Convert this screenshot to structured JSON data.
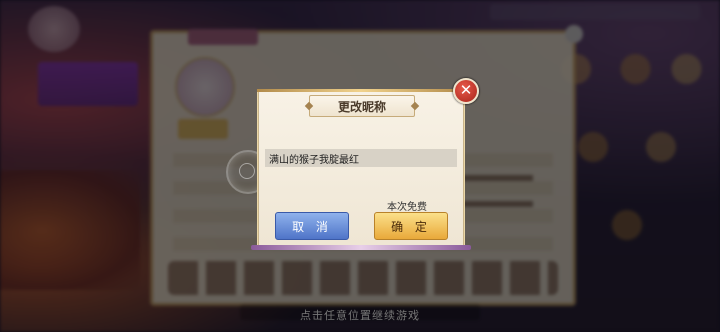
{
  "dialog": {
    "title": "更改昵称",
    "name_value": "满山的猴子我腚最红",
    "cost_note": "本次免费",
    "cancel_label": "取 消",
    "confirm_label": "确 定",
    "close_icon_glyph": "✕"
  },
  "footer": {
    "hint": "点击任意位置继续游戏"
  },
  "colors": {
    "cancel_button": "#5b80d0",
    "confirm_button": "#f0c060",
    "dialog_bg": "#f5eee0"
  },
  "icons": [
    "close-icon",
    "loading-spinner-icon"
  ]
}
